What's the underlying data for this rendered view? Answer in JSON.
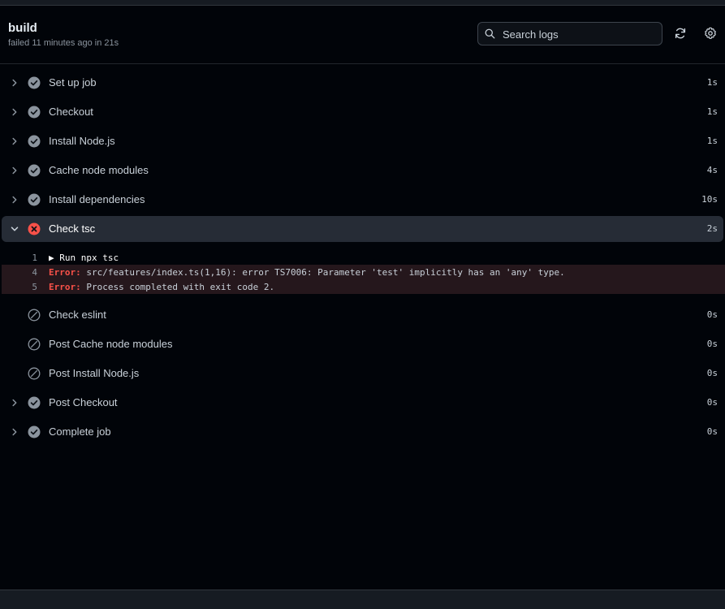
{
  "job": {
    "title": "build",
    "status_line": "failed 11 minutes ago in 21s"
  },
  "search": {
    "placeholder": "Search logs"
  },
  "colors": {
    "success": "#8b949e",
    "failure": "#f85149",
    "skipped": "#8b949e"
  },
  "steps": [
    {
      "label": "Set up job",
      "duration": "1s",
      "status": "success",
      "icon": "check-circle-icon"
    },
    {
      "label": "Checkout",
      "duration": "1s",
      "status": "success",
      "icon": "check-circle-icon"
    },
    {
      "label": "Install Node.js",
      "duration": "1s",
      "status": "success",
      "icon": "check-circle-icon"
    },
    {
      "label": "Cache node modules",
      "duration": "4s",
      "status": "success",
      "icon": "check-circle-icon"
    },
    {
      "label": "Install dependencies",
      "duration": "10s",
      "status": "success",
      "icon": "check-circle-icon"
    },
    {
      "label": "Check tsc",
      "duration": "2s",
      "status": "failure",
      "icon": "x-circle-icon"
    },
    {
      "label": "Check eslint",
      "duration": "0s",
      "status": "skipped",
      "icon": "skip-icon"
    },
    {
      "label": "Post Cache node modules",
      "duration": "0s",
      "status": "skipped",
      "icon": "skip-icon"
    },
    {
      "label": "Post Install Node.js",
      "duration": "0s",
      "status": "skipped",
      "icon": "skip-icon"
    },
    {
      "label": "Post Checkout",
      "duration": "0s",
      "status": "success",
      "icon": "check-circle-icon"
    },
    {
      "label": "Complete job",
      "duration": "0s",
      "status": "success",
      "icon": "check-circle-icon"
    }
  ],
  "log": {
    "lines": [
      {
        "num": "1",
        "prefix": "",
        "text": "▶ Run npx tsc"
      },
      {
        "num": "4",
        "prefix": "Error: ",
        "text": "src/features/index.ts(1,16): error TS7006: Parameter 'test' implicitly has an 'any' type."
      },
      {
        "num": "5",
        "prefix": "Error: ",
        "text": "Process completed with exit code 2."
      }
    ]
  }
}
